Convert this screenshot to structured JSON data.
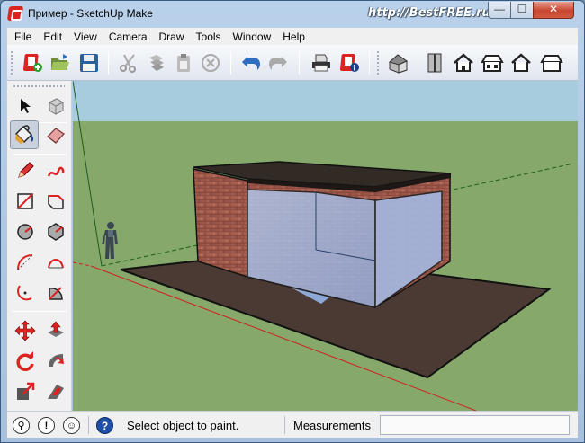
{
  "window": {
    "title": "Пример - SketchUp Make",
    "watermark": "http://BestFREE.ru",
    "min_glyph": "—",
    "max_glyph": "☐",
    "close_glyph": "✕"
  },
  "menu": [
    "File",
    "Edit",
    "View",
    "Camera",
    "Draw",
    "Tools",
    "Window",
    "Help"
  ],
  "toolbar": {
    "groups": [
      [
        "new-model",
        "open-folder",
        "save-floppy"
      ],
      [
        "cut-scissors",
        "copy",
        "paste",
        "erase-circle"
      ],
      [
        "undo-arrow",
        "redo-arrow"
      ],
      [
        "print",
        "model-info"
      ],
      [
        "iso-view",
        "top-view",
        "front-view",
        "right-view",
        "back-view",
        "left-view"
      ]
    ]
  },
  "palette": {
    "tools": [
      "select-arrow",
      "make-component",
      "paint-bucket",
      "eraser",
      "line-pencil",
      "freehand",
      "rectangle",
      "rotated-rectangle",
      "circle",
      "polygon",
      "arc",
      "two-point-arc",
      "three-point-arc",
      "pie",
      "move",
      "push-pull",
      "rotate",
      "follow-me",
      "scale",
      "offset"
    ],
    "active_tool": "paint-bucket"
  },
  "status": {
    "message": "Select object to paint.",
    "measurements_label": "Measurements",
    "measurements_value": "",
    "help_glyph": "?"
  },
  "colors": {
    "sky": "#a6ccdd",
    "ground": "#87a86b",
    "brick": "#9a5548",
    "glass": "#9fb5dd",
    "slab": "#4a3a33",
    "roof": "#312a25"
  }
}
